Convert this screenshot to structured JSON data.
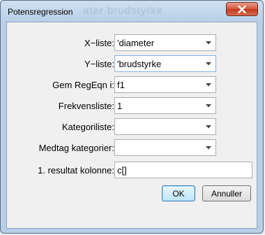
{
  "window": {
    "title": "Potensregression",
    "background_ghost_text": "ater   brudstyrke"
  },
  "form": {
    "x_list": {
      "label": "X−liste:",
      "value": "'diameter"
    },
    "y_list": {
      "label": "Y−liste:",
      "value": "'brudstyrke"
    },
    "save_regeqn": {
      "label": "Gem RegEqn i:",
      "value": "f1"
    },
    "freq_list": {
      "label": "Frekvensliste:",
      "value": "1"
    },
    "category_list": {
      "label": "Kategoriliste:",
      "value": ""
    },
    "include_categories": {
      "label": "Medtag kategorier:",
      "value": ""
    },
    "first_result_column": {
      "label": "1. resultat kolonne:",
      "value": "c[]"
    }
  },
  "buttons": {
    "ok": "OK",
    "cancel": "Annuller"
  },
  "colors": {
    "close_button": "#c0391a",
    "frame": "#b9cfe7",
    "focus_border": "#7eb4ea"
  }
}
